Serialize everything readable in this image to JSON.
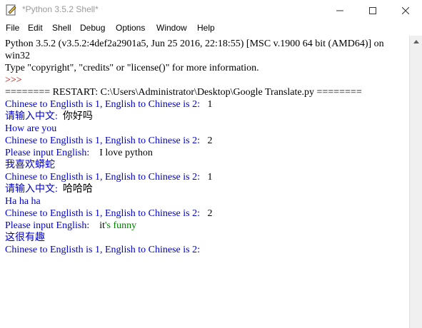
{
  "window": {
    "title": "*Python 3.5.2 Shell*"
  },
  "menu": [
    "File",
    "Edit",
    "Shell",
    "Debug",
    "Options",
    "Window",
    "Help"
  ],
  "shell": {
    "banner1": "Python 3.5.2 (v3.5.2:4def2a2901a5, Jun 25 2016, 22:18:55) [MSC v.1900 64 bit (AMD64)] on",
    "banner2": "win32",
    "banner3": "Type \"copyright\", \"credits\" or \"license()\" for more information.",
    "prompt": ">>>",
    "restart": "======== RESTART: C:\\Users\\Administrator\\Desktop\\Google Translate.py ========",
    "l1_prompt": "Chinese to Englisth is 1, English to Chinese is 2:",
    "l1_input": "1",
    "l2_prompt": "请输入中文:",
    "l2_input": "你好吗",
    "l3_output": "How are you",
    "l4_prompt": "Chinese to Englisth is 1, English to Chinese is 2:",
    "l4_input": "2",
    "l5_prompt": "Please input English:",
    "l5_input": "I love python",
    "l6_output": "我喜欢蟒蛇",
    "l7_prompt": "Chinese to Englisth is 1, English to Chinese is 2:",
    "l7_input": "1",
    "l8_prompt": "请输入中文:",
    "l8_input": "哈哈哈",
    "l9_output": "Ha ha ha",
    "l10_prompt": "Chinese to Englisth is 1, English to Chinese is 2:",
    "l10_input": "2",
    "l11_prompt": "Please input English:",
    "l11_input_a": "it",
    "l11_input_b": "'s funny",
    "l12_output": "这很有趣",
    "l13_prompt": "Chinese to Englisth is 1, English to Chinese is 2:"
  }
}
